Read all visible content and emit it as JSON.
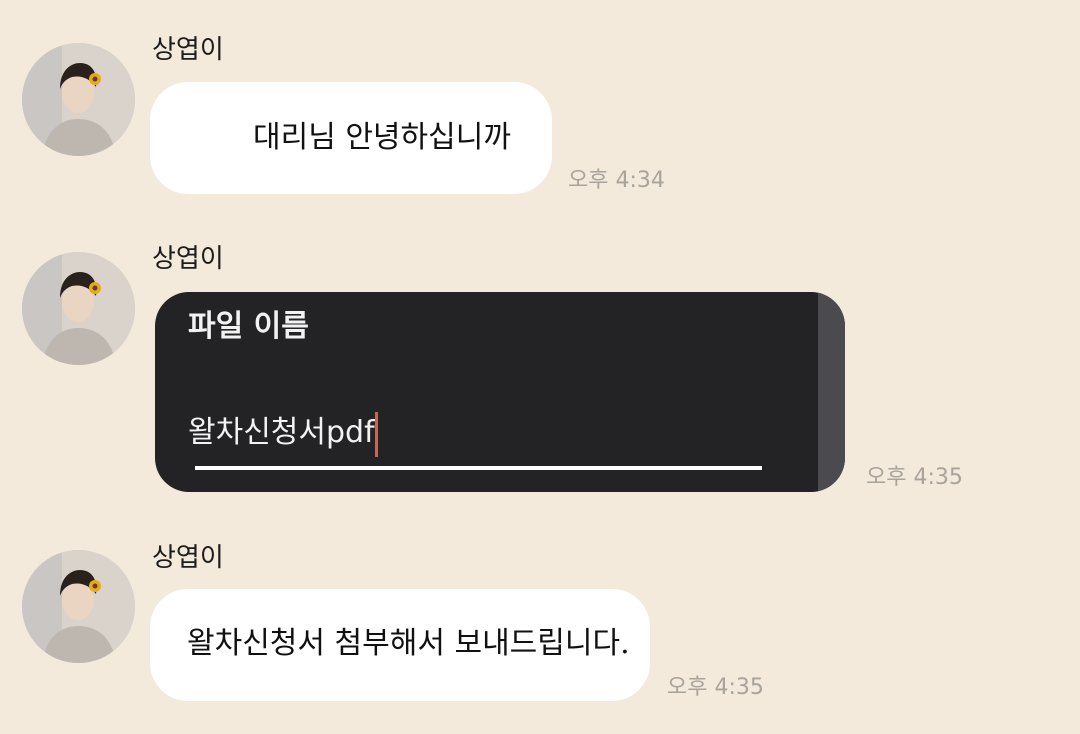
{
  "messages": [
    {
      "sender": "상엽이",
      "text": "대리님 안녕하십니까",
      "time": "오후 4:34",
      "avatar_icon": "profile-photo-icon"
    },
    {
      "sender": "상엽이",
      "time": "오후 4:35",
      "avatar_icon": "profile-photo-icon",
      "attachment": {
        "title": "파일 이름",
        "value": "왈차신청서pdf"
      }
    },
    {
      "sender": "상엽이",
      "text": "왈차신청서 첨부해서 보내드립니다.",
      "time": "오후 4:35",
      "avatar_icon": "profile-photo-icon"
    }
  ],
  "colors": {
    "background": "#f3eadb",
    "bubble": "#ffffff",
    "dark_card": "#232325",
    "caret": "#e35b44",
    "time_text": "#a8a39b"
  }
}
